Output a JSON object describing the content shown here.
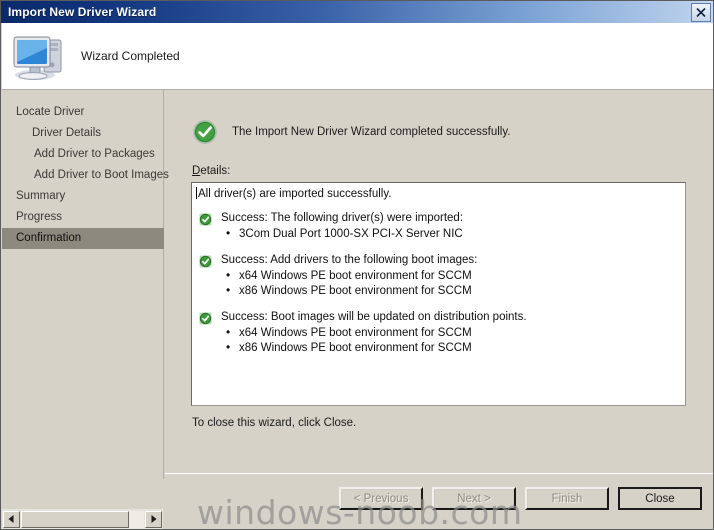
{
  "window": {
    "title": "Import New Driver Wizard",
    "close_icon": "close-icon"
  },
  "header": {
    "icon": "computer-icon",
    "title": "Wizard Completed"
  },
  "sidebar": {
    "items": [
      {
        "label": "Locate Driver",
        "indent": 0,
        "current": false
      },
      {
        "label": "Driver Details",
        "indent": 1,
        "current": false
      },
      {
        "label": "Add Driver to Packages",
        "indent": 2,
        "current": false
      },
      {
        "label": "Add Driver to Boot Images",
        "indent": 2,
        "current": false
      },
      {
        "label": "Summary",
        "indent": 0,
        "current": false
      },
      {
        "label": "Progress",
        "indent": 0,
        "current": false
      },
      {
        "label": "Confirmation",
        "indent": 0,
        "current": true
      }
    ]
  },
  "content": {
    "status_icon": "success-check-icon",
    "status_text": "The Import New Driver Wizard completed successfully.",
    "details_label": "Details:",
    "details": {
      "first_line": "All driver(s) are imported successfully.",
      "groups": [
        {
          "icon": "success-check-icon",
          "heading": "Success: The following driver(s) were imported:",
          "items": [
            "3Com Dual Port 1000-SX PCI-X Server NIC"
          ]
        },
        {
          "icon": "success-check-icon",
          "heading": "Success: Add drivers to the following boot images:",
          "items": [
            "x64 Windows PE boot environment for SCCM",
            "x86 Windows PE boot environment for SCCM"
          ]
        },
        {
          "icon": "success-check-icon",
          "heading": "Success: Boot images will be updated on distribution points.",
          "items": [
            "x64 Windows PE boot environment for SCCM",
            "x86 Windows PE boot environment for SCCM"
          ]
        }
      ]
    },
    "close_hint": "To close this wizard, click Close."
  },
  "footer": {
    "buttons": [
      {
        "label": "< Previous",
        "state": "disabled"
      },
      {
        "label": "Next >",
        "state": "disabled"
      },
      {
        "label": "Finish",
        "state": "disabled"
      },
      {
        "label": "Close",
        "state": "default"
      }
    ]
  },
  "scrollbar": {
    "left_arrow_icon": "arrow-left-icon",
    "right_arrow_icon": "arrow-right-icon"
  },
  "watermark": {
    "text": "windows-noob.com"
  },
  "colors": {
    "title_start": "#0a2a6b",
    "title_end": "#c9dcf2",
    "body": "#d6d2c8",
    "success_green": "#3c9a3c",
    "selection": "#8d897e"
  }
}
